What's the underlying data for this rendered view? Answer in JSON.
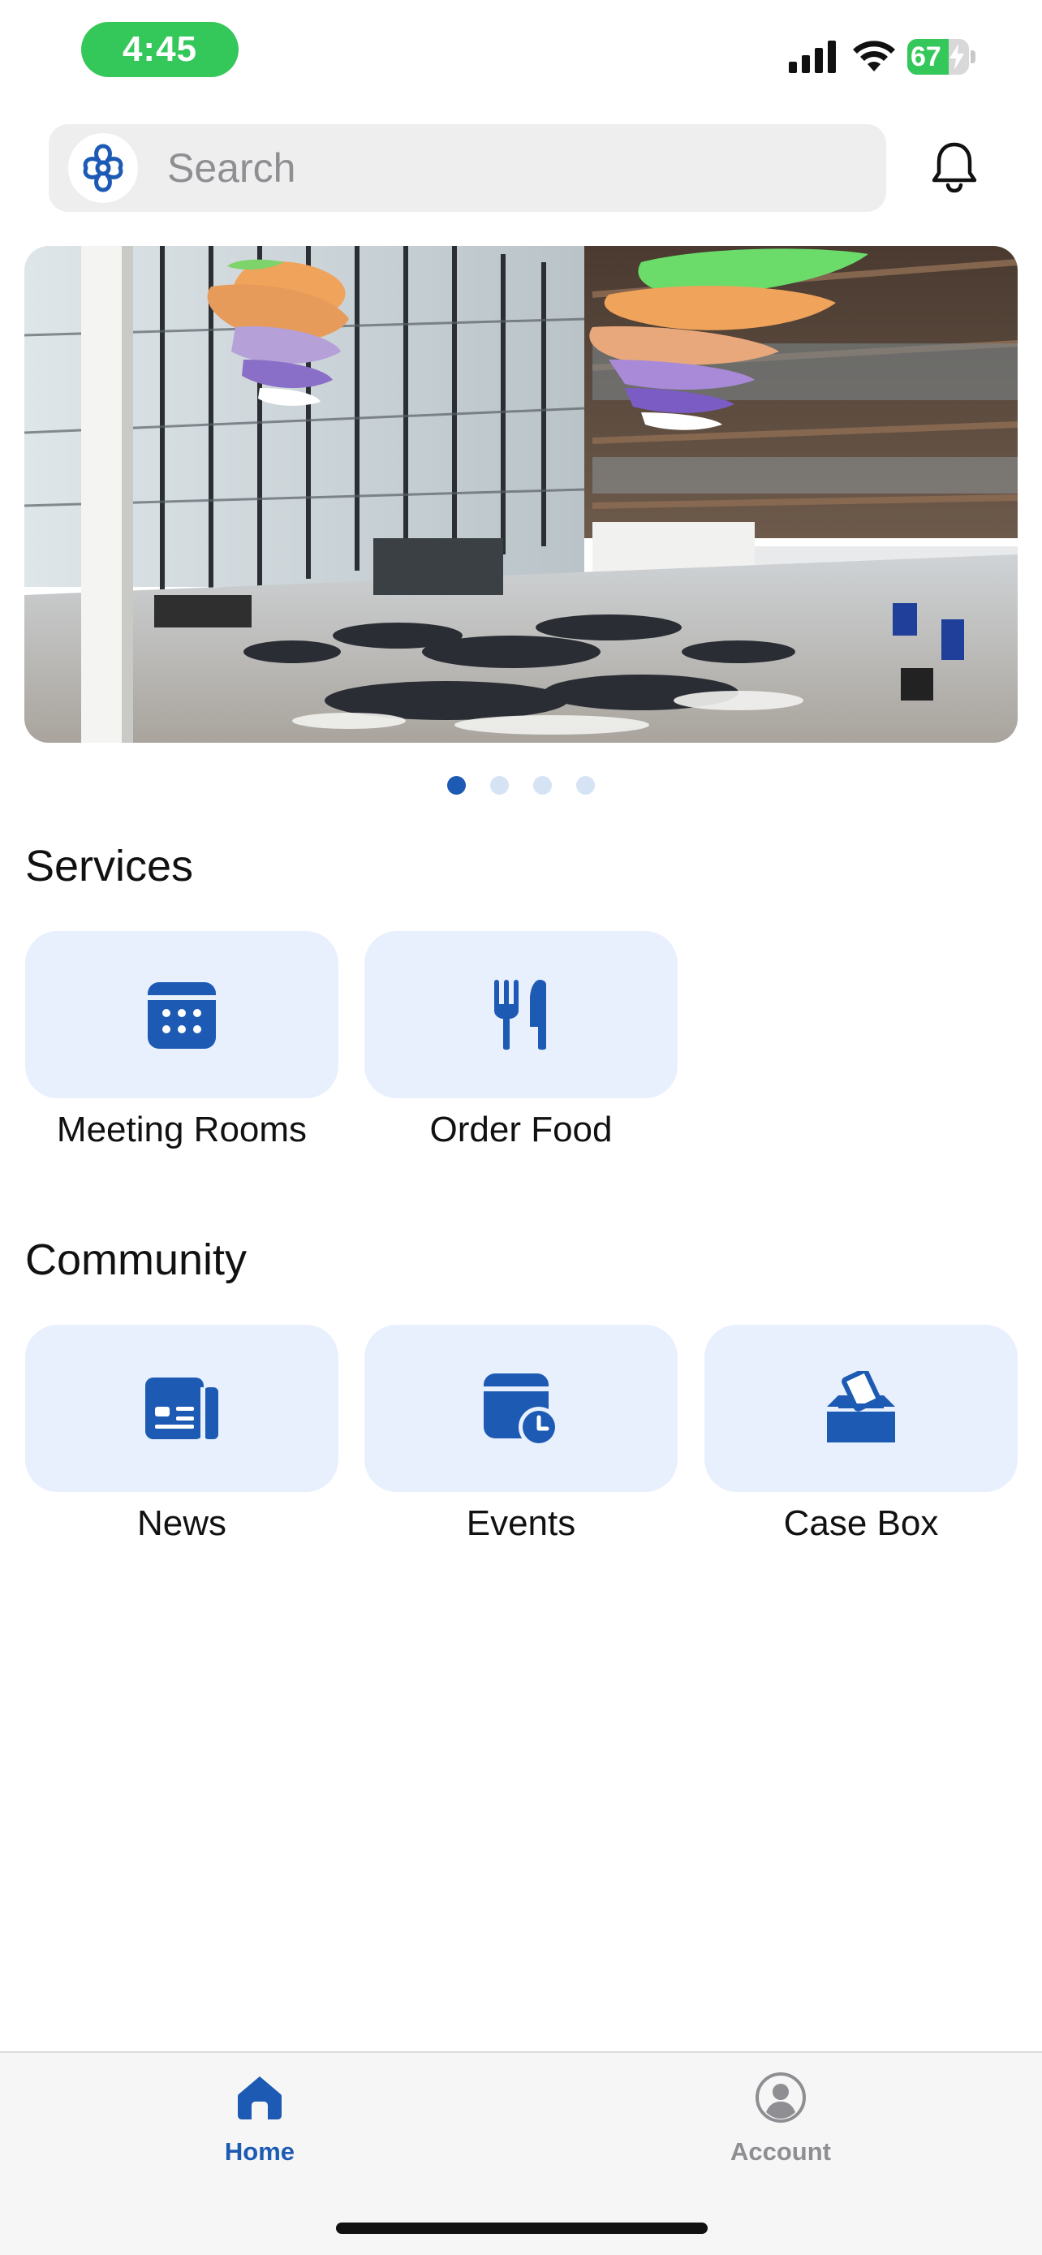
{
  "status_bar": {
    "time": "4:45",
    "battery_percent": "67",
    "battery_level": 0.67,
    "icons": [
      "signal-icon",
      "wifi-icon",
      "battery-icon",
      "charging-bolt-icon"
    ]
  },
  "search": {
    "placeholder": "Search",
    "logo_icon": "app-logo-icon",
    "notification_icon": "bell-icon"
  },
  "carousel": {
    "image": "conference-hall-photo",
    "page_count": 4,
    "active_index": 0
  },
  "services": {
    "title": "Services",
    "items": [
      {
        "label": "Meeting Rooms",
        "icon": "calendar-icon"
      },
      {
        "label": "Order Food",
        "icon": "fork-knife-icon"
      }
    ]
  },
  "community": {
    "title": "Community",
    "items": [
      {
        "label": "News",
        "icon": "newspaper-icon"
      },
      {
        "label": "Events",
        "icon": "calendar-clock-icon"
      },
      {
        "label": "Case Box",
        "icon": "ballot-box-icon"
      }
    ]
  },
  "tab_bar": {
    "tabs": [
      {
        "label": "Home",
        "icon": "home-icon",
        "active": true
      },
      {
        "label": "Account",
        "icon": "account-icon",
        "active": false
      }
    ]
  },
  "colors": {
    "accent": "#1d5ab4",
    "tile_background": "#e8f0fd",
    "status_green": "#34c759",
    "inactive_tab": "#8e8e93"
  }
}
